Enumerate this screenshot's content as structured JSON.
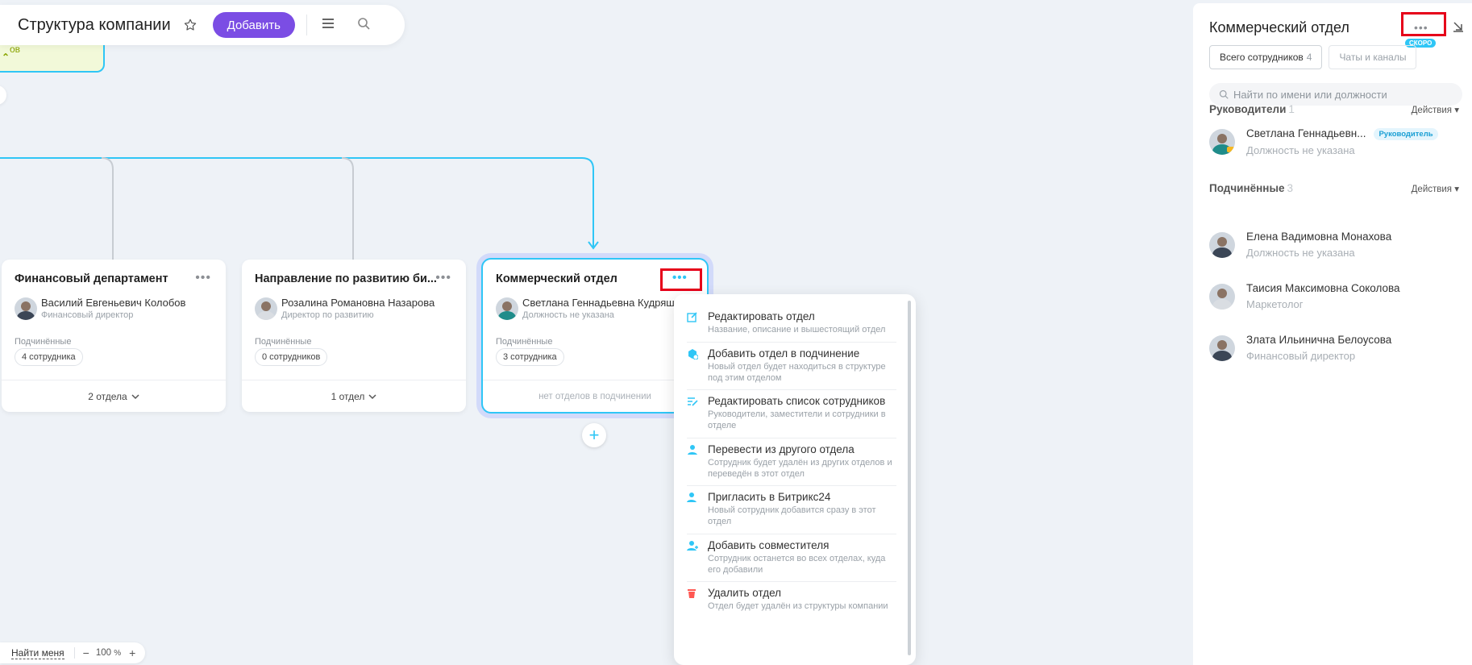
{
  "header": {
    "title": "Структура компании",
    "add_label": "Добавить"
  },
  "root_node": {
    "label": "ов"
  },
  "cards": [
    {
      "title": "Финансовый департамент",
      "person_name": "Василий Евгеньевич Колобов",
      "person_role": "Финансовый директор",
      "sub_label": "Подчинённые",
      "chip": "4 сотрудника",
      "footer": "2 отдела"
    },
    {
      "title": "Направление по развитию би...",
      "person_name": "Розалина Романовна Назарова",
      "person_role": "Директор по развитию",
      "sub_label": "Подчинённые",
      "chip": "0 сотрудников",
      "footer": "1 отдел"
    },
    {
      "title": "Коммерческий отдел",
      "person_name": "Светлана Геннадьевна Кудряш",
      "person_role": "Должность не указана",
      "sub_label": "Подчинённые",
      "chip": "3 сотрудника",
      "footer": "нет отделов в подчинении"
    }
  ],
  "context_menu": {
    "items": [
      {
        "title": "Редактировать отдел",
        "desc": "Название, описание и вышестоящий отдел",
        "icon": "edit-icon"
      },
      {
        "title": "Добавить отдел в подчинение",
        "desc": "Новый отдел будет находиться в структуре под этим отделом",
        "icon": "add-department-icon"
      },
      {
        "title": "Редактировать список сотрудников",
        "desc": "Руководители, заместители и сотрудники в отделе",
        "icon": "edit-list-icon"
      },
      {
        "title": "Перевести из другого отдела",
        "desc": "Сотрудник будет удалён из других отделов и переведён в этот отдел",
        "icon": "transfer-icon"
      },
      {
        "title": "Пригласить в Битрикс24",
        "desc": "Новый сотрудник добавится сразу в этот отдел",
        "icon": "invite-user-icon"
      },
      {
        "title": "Добавить совместителя",
        "desc": "Сотрудник останется во всех отделах, куда его добавили",
        "icon": "add-user-icon"
      },
      {
        "title": "Удалить отдел",
        "desc": "Отдел будет удалён из структуры компании",
        "icon": "trash-icon"
      }
    ]
  },
  "bottom_bar": {
    "find_me": "Найти меня",
    "zoom_value": "100",
    "zoom_unit": "%"
  },
  "panel": {
    "title": "Коммерческий отдел",
    "soon_badge": "СКОРО",
    "tab_employees": "Всего сотрудников",
    "tab_employees_count": "4",
    "tab_chats": "Чаты и каналы",
    "search_placeholder": "Найти по имени или должности",
    "heads_title": "Руководители",
    "heads_count": "1",
    "subordinates_title": "Подчинённые",
    "subordinates_count": "3",
    "actions_label": "Действия",
    "head": {
      "name": "Светлана Геннадьевн...",
      "badge": "Руководитель",
      "role": "Должность не указана"
    },
    "employees": [
      {
        "name": "Елена Вадимовна Монахова",
        "role": "Должность не указана"
      },
      {
        "name": "Таисия Максимовна Соколова",
        "role": "Маркетолог"
      },
      {
        "name": "Злата Ильинична Белоусова",
        "role": "Финансовый директор"
      }
    ]
  },
  "colors": {
    "accent_purple": "#7b4de4",
    "accent_blue": "#2fc6f6",
    "highlight_red": "#e6001a",
    "canvas_bg": "#eef2f7"
  }
}
